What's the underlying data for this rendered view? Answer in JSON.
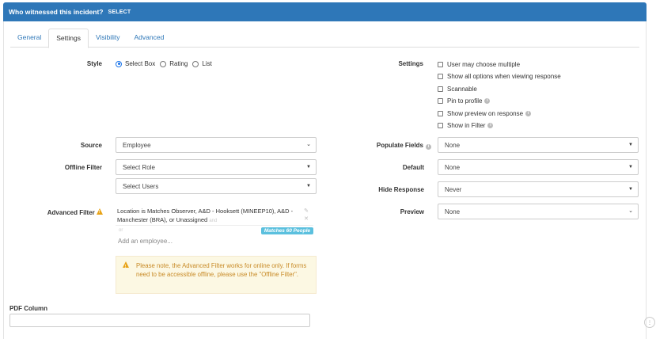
{
  "header": {
    "question": "Who witnessed this incident?",
    "type": "SELECT"
  },
  "tabs": [
    "General",
    "Settings",
    "Visibility",
    "Advanced"
  ],
  "style": {
    "label": "Style",
    "options": [
      "Select Box",
      "Rating",
      "List"
    ],
    "selected": "Select Box"
  },
  "settings": {
    "label": "Settings",
    "options": [
      {
        "label": "User may choose multiple",
        "info": false
      },
      {
        "label": "Show all options when viewing response",
        "info": false
      },
      {
        "label": "Scannable",
        "info": false
      },
      {
        "label": "Pin to profile",
        "info": true
      },
      {
        "label": "Show preview on response",
        "info": true
      },
      {
        "label": "Show in Filter",
        "info": true
      }
    ]
  },
  "source": {
    "label": "Source",
    "value": "Employee"
  },
  "offline_filter": {
    "label": "Offline Filter",
    "role_value": "Select Role",
    "users_value": "Select Users"
  },
  "advanced_filter": {
    "label": "Advanced Filter",
    "condition": "Location is Matches Observer, A&D - Hooksett (MINEEP10), A&D - Manchester (BRA), or Unassigned",
    "and_text": "and",
    "or_text": "or",
    "matches": "Matches 60 People",
    "placeholder": "Add an employee...",
    "warning": "Please note, the Advanced Filter works for online only. If forms need to be accessible offline, please use the \"Offline Filter\"."
  },
  "populate_fields": {
    "label": "Populate Fields",
    "value": "None"
  },
  "default": {
    "label": "Default",
    "value": "None"
  },
  "hide_response": {
    "label": "Hide Response",
    "value": "Never"
  },
  "preview": {
    "label": "Preview",
    "value": "None"
  },
  "pdf_column": {
    "label": "PDF Column",
    "value": ""
  },
  "colors": {
    "header": "#2e77b8",
    "link": "#2e77b8",
    "badge": "#5bc0de",
    "warning": "#e8a317"
  }
}
